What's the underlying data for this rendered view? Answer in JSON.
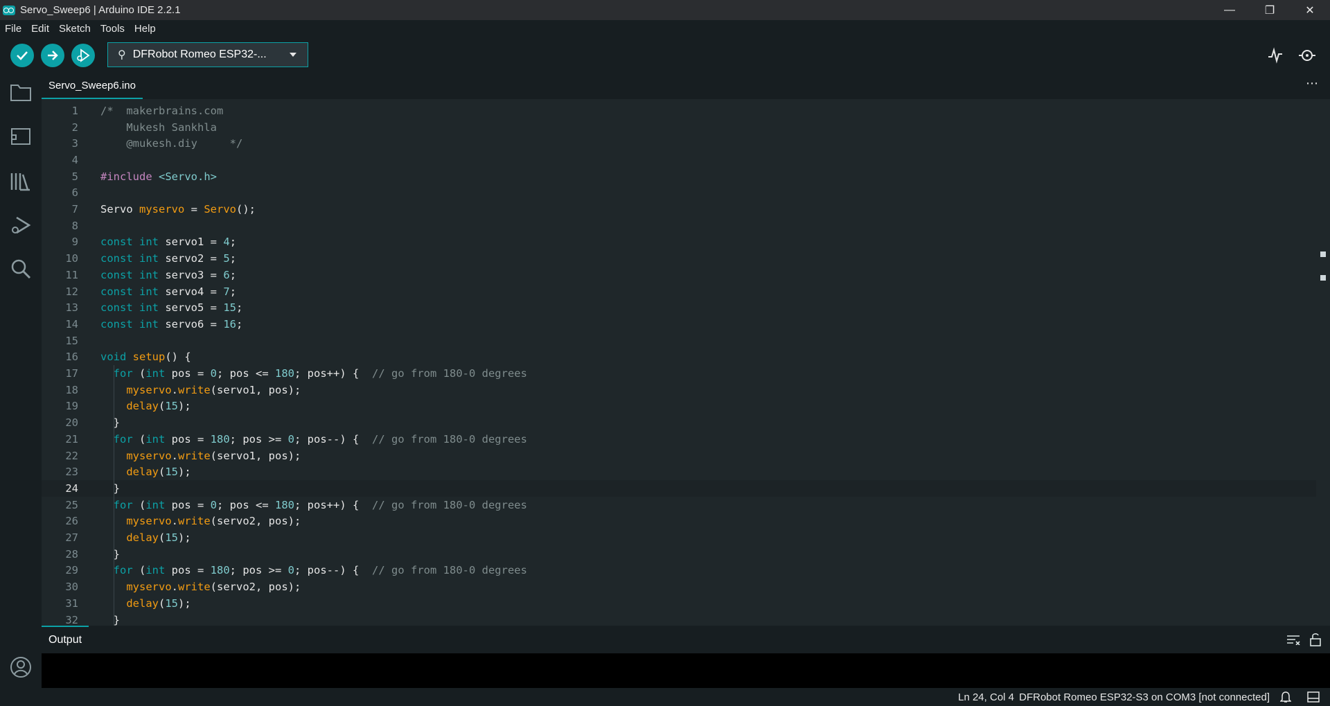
{
  "window": {
    "title": "Servo_Sweep6 | Arduino IDE 2.2.1",
    "controls": {
      "minimize": "—",
      "restore": "❐",
      "close": "✕"
    }
  },
  "menu": [
    "File",
    "Edit",
    "Sketch",
    "Tools",
    "Help"
  ],
  "toolbar": {
    "verify_icon": "check-icon",
    "upload_icon": "arrow-right-icon",
    "debug_icon": "debug-icon",
    "board_label": "DFRobot Romeo ESP32-...",
    "serial_plotter_icon": "plotter-icon",
    "serial_monitor_icon": "serial-monitor-icon"
  },
  "activity_bar": [
    "folder-icon",
    "board-manager-icon",
    "library-icon",
    "debug-icon",
    "search-icon",
    "account-icon"
  ],
  "tab": {
    "filename": "Servo_Sweep6.ino",
    "more": "⋯"
  },
  "editor": {
    "current_line": 24,
    "lines": [
      "/*  makerbrains.com",
      "    Mukesh Sankhla",
      "    @mukesh.diy     */",
      "",
      "#include <Servo.h>",
      "",
      "Servo myservo = Servo();",
      "",
      "const int servo1 = 4;",
      "const int servo2 = 5;",
      "const int servo3 = 6;",
      "const int servo4 = 7;",
      "const int servo5 = 15;",
      "const int servo6 = 16;",
      "",
      "void setup() {",
      "  for (int pos = 0; pos <= 180; pos++) {  // go from 180-0 degrees",
      "    myservo.write(servo1, pos);",
      "    delay(15);",
      "  }",
      "  for (int pos = 180; pos >= 0; pos--) {  // go from 180-0 degrees",
      "    myservo.write(servo1, pos);",
      "    delay(15);",
      "  }",
      "  for (int pos = 0; pos <= 180; pos++) {  // go from 180-0 degrees",
      "    myservo.write(servo2, pos);",
      "    delay(15);",
      "  }",
      "  for (int pos = 180; pos >= 0; pos--) {  // go from 180-0 degrees",
      "    myservo.write(servo2, pos);",
      "    delay(15);",
      "  }"
    ]
  },
  "output": {
    "title": "Output",
    "clear_icon": "clear-output-icon",
    "lock_icon": "unlock-icon"
  },
  "status": {
    "position": "Ln 24, Col 4",
    "board": "DFRobot Romeo ESP32-S3 on COM3 [not connected]",
    "notifications_icon": "bell-icon",
    "panel_icon": "toggle-panel-icon"
  },
  "colors": {
    "accent": "#0ca1a6",
    "background": "#1f272a",
    "sidebar": "#171e21"
  }
}
